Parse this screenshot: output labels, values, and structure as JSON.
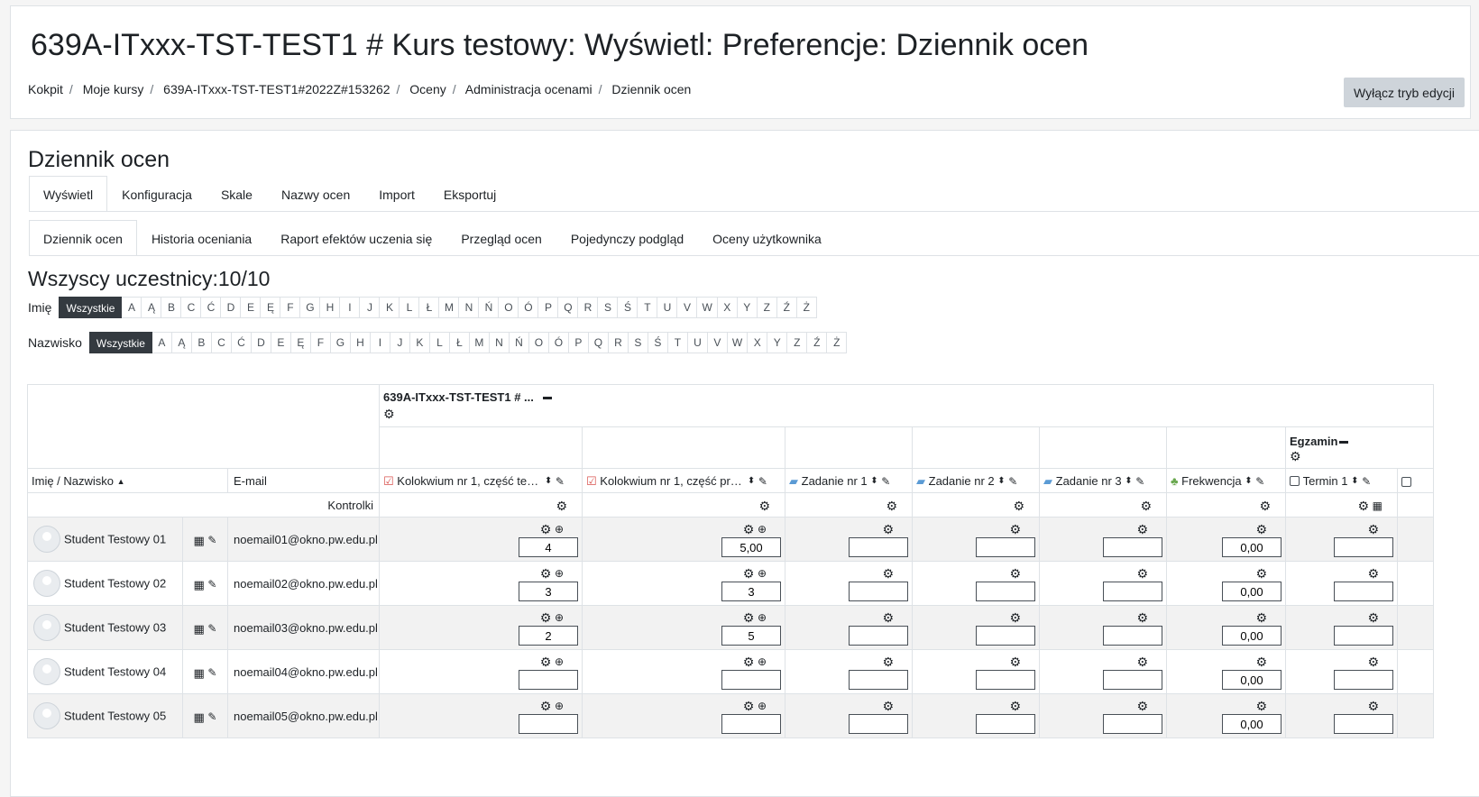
{
  "header": {
    "title": "639A-ITxxx-TST-TEST1 # Kurs testowy: Wyświetl: Preferencje: Dziennik ocen",
    "breadcrumb": [
      "Kokpit",
      "Moje kursy",
      "639A-ITxxx-TST-TEST1#2022Z#153262",
      "Oceny",
      "Administracja ocenami",
      "Dziennik ocen"
    ],
    "edit_button": "Wyłącz tryb edycji"
  },
  "main": {
    "section_title": "Dziennik ocen",
    "tabs": [
      "Wyświetl",
      "Konfiguracja",
      "Skale",
      "Nazwy ocen",
      "Import",
      "Eksportuj"
    ],
    "subtabs": [
      "Dziennik ocen",
      "Historia oceniania",
      "Raport efektów uczenia się",
      "Przegląd ocen",
      "Pojedynczy podgląd",
      "Oceny użytkownika"
    ],
    "participants": "Wszyscy uczestnicy:10/10",
    "first_name_label": "Imię",
    "last_name_label": "Nazwisko",
    "all_label": "Wszystkie",
    "letters": [
      "A",
      "Ą",
      "B",
      "C",
      "Ć",
      "D",
      "E",
      "Ę",
      "F",
      "G",
      "H",
      "I",
      "J",
      "K",
      "L",
      "Ł",
      "M",
      "N",
      "Ń",
      "O",
      "Ó",
      "P",
      "Q",
      "R",
      "S",
      "Ś",
      "T",
      "U",
      "V",
      "W",
      "X",
      "Y",
      "Z",
      "Ź",
      "Ż"
    ]
  },
  "grader": {
    "course_header": "639A-ITxxx-TST-TEST1 # ...",
    "exam_category": "Egzamin",
    "name_column": "Imię / Nazwisko",
    "email_column": "E-mail",
    "controls_label": "Kontrolki",
    "items": [
      {
        "name": "Kolokwium nr 1, część test...",
        "icon": "quiz-icon"
      },
      {
        "name": "Kolokwium nr 1, część pra...",
        "icon": "quiz-icon"
      },
      {
        "name": "Zadanie nr 1",
        "icon": "assignment-icon"
      },
      {
        "name": "Zadanie nr 2",
        "icon": "assignment-icon"
      },
      {
        "name": "Zadanie nr 3",
        "icon": "assignment-icon"
      },
      {
        "name": "Frekwencja",
        "icon": "attendance-icon"
      },
      {
        "name": "Termin 1",
        "icon": "manual-item-icon"
      }
    ],
    "students": [
      {
        "name": "Student Testowy 01",
        "email": "noemail01@okno.pw.edu.pl",
        "grades": [
          "4",
          "5,00",
          "",
          "",
          "",
          "0,00",
          ""
        ]
      },
      {
        "name": "Student Testowy 02",
        "email": "noemail02@okno.pw.edu.pl",
        "grades": [
          "3",
          "3",
          "",
          "",
          "",
          "0,00",
          ""
        ]
      },
      {
        "name": "Student Testowy 03",
        "email": "noemail03@okno.pw.edu.pl",
        "grades": [
          "2",
          "5",
          "",
          "",
          "",
          "0,00",
          ""
        ]
      },
      {
        "name": "Student Testowy 04",
        "email": "noemail04@okno.pw.edu.pl",
        "grades": [
          "",
          "",
          "",
          "",
          "",
          "0,00",
          ""
        ]
      },
      {
        "name": "Student Testowy 05",
        "email": "noemail05@okno.pw.edu.pl",
        "grades": [
          "",
          "",
          "",
          "",
          "",
          "0,00",
          ""
        ]
      }
    ]
  },
  "colors": {
    "accent_dark": "#343a40",
    "border": "#dee2e6",
    "button_bg": "#ced4da"
  }
}
